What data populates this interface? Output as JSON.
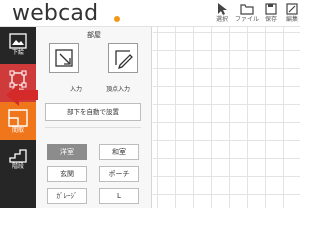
{
  "header": {
    "logo_text": "webcad",
    "tools": [
      {
        "label": "選択",
        "icon": "cursor-arrow-icon"
      },
      {
        "label": "ファイル",
        "icon": "folder-icon"
      },
      {
        "label": "保存",
        "icon": "save-icon"
      },
      {
        "label": "編集",
        "icon": "edit-icon"
      }
    ]
  },
  "sidebar": {
    "items": [
      {
        "label": "下絵",
        "icon": "underlay-image-icon"
      },
      {
        "label": "敷地",
        "icon": "site-polygon-icon"
      },
      {
        "label": "間取",
        "icon": "floor-plan-icon"
      },
      {
        "label": "階段",
        "icon": "stairs-icon"
      }
    ]
  },
  "panel": {
    "title": "部屋",
    "modes": [
      {
        "label": "入力",
        "icon": "rectangle-input-icon"
      },
      {
        "label": "頂点入力",
        "icon": "vertex-input-icon"
      }
    ],
    "auto_button": "部下を自動で設置",
    "rooms": [
      "洋室",
      "和室",
      "玄関",
      "ポーチ",
      "ｶﾞﾚｰｼﾞ",
      "L"
    ],
    "active_room": "洋室"
  },
  "colors": {
    "sidebar_bg": "#262626",
    "site_active": "#cf3b3b",
    "floorplan_accent": "#f0761b",
    "logo_dot": "#f29a16",
    "pointer_arrow": "#d42a2a"
  }
}
